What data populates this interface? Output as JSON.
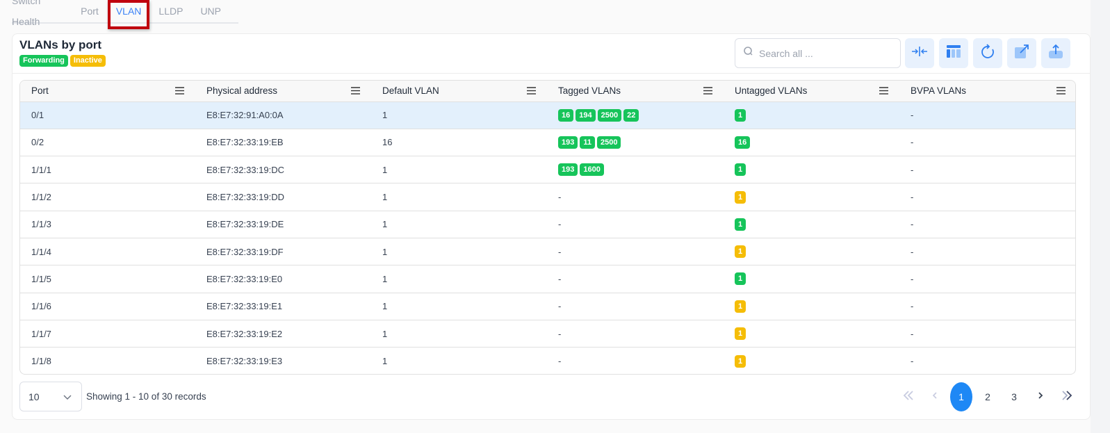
{
  "tabs": [
    {
      "label": "Switch Health",
      "active": false
    },
    {
      "label": "Port",
      "active": false
    },
    {
      "label": "VLAN",
      "active": true
    },
    {
      "label": "LLDP",
      "active": false
    },
    {
      "label": "UNP",
      "active": false
    }
  ],
  "card": {
    "title": "VLANs by port",
    "legend": [
      {
        "label": "Forwarding",
        "color": "#16c45a"
      },
      {
        "label": "Inactive",
        "color": "#f5bd07"
      }
    ],
    "search": {
      "placeholder": "Search all ...",
      "value": ""
    },
    "toolbar": [
      "collapse-columns-icon",
      "column-layout-icon",
      "refresh-icon",
      "open-external-icon",
      "export-icon"
    ]
  },
  "table": {
    "columns": [
      "Port",
      "Physical address",
      "Default VLAN",
      "Tagged VLANs",
      "Untagged VLANs",
      "BVPA VLANs"
    ],
    "rows": [
      {
        "port": "0/1",
        "mac": "E8:E7:32:91:A0:0A",
        "default_vlan": "1",
        "tagged": [
          "16",
          "194",
          "2500",
          "22"
        ],
        "untagged": {
          "value": "1",
          "status": "forwarding"
        },
        "bvpa": "-",
        "selected": true
      },
      {
        "port": "0/2",
        "mac": "E8:E7:32:33:19:EB",
        "default_vlan": "16",
        "tagged": [
          "193",
          "11",
          "2500"
        ],
        "untagged": {
          "value": "16",
          "status": "forwarding"
        },
        "bvpa": "-"
      },
      {
        "port": "1/1/1",
        "mac": "E8:E7:32:33:19:DC",
        "default_vlan": "1",
        "tagged": [
          "193",
          "1600"
        ],
        "untagged": {
          "value": "1",
          "status": "forwarding"
        },
        "bvpa": "-"
      },
      {
        "port": "1/1/2",
        "mac": "E8:E7:32:33:19:DD",
        "default_vlan": "1",
        "tagged": [],
        "untagged": {
          "value": "1",
          "status": "inactive"
        },
        "bvpa": "-"
      },
      {
        "port": "1/1/3",
        "mac": "E8:E7:32:33:19:DE",
        "default_vlan": "1",
        "tagged": [],
        "untagged": {
          "value": "1",
          "status": "forwarding"
        },
        "bvpa": "-"
      },
      {
        "port": "1/1/4",
        "mac": "E8:E7:32:33:19:DF",
        "default_vlan": "1",
        "tagged": [],
        "untagged": {
          "value": "1",
          "status": "inactive"
        },
        "bvpa": "-"
      },
      {
        "port": "1/1/5",
        "mac": "E8:E7:32:33:19:E0",
        "default_vlan": "1",
        "tagged": [],
        "untagged": {
          "value": "1",
          "status": "forwarding"
        },
        "bvpa": "-"
      },
      {
        "port": "1/1/6",
        "mac": "E8:E7:32:33:19:E1",
        "default_vlan": "1",
        "tagged": [],
        "untagged": {
          "value": "1",
          "status": "inactive"
        },
        "bvpa": "-"
      },
      {
        "port": "1/1/7",
        "mac": "E8:E7:32:33:19:E2",
        "default_vlan": "1",
        "tagged": [],
        "untagged": {
          "value": "1",
          "status": "inactive"
        },
        "bvpa": "-"
      },
      {
        "port": "1/1/8",
        "mac": "E8:E7:32:33:19:E3",
        "default_vlan": "1",
        "tagged": [],
        "untagged": {
          "value": "1",
          "status": "inactive"
        },
        "bvpa": "-"
      }
    ],
    "empty_placeholder": "-"
  },
  "footer": {
    "page_size": "10",
    "records_text": "Showing 1 - 10 of 30 records",
    "pages": [
      "1",
      "2",
      "3"
    ],
    "current_page": "1"
  },
  "colors": {
    "forwarding": "#16c45a",
    "inactive": "#f5bd07",
    "accent": "#1e88f5"
  }
}
